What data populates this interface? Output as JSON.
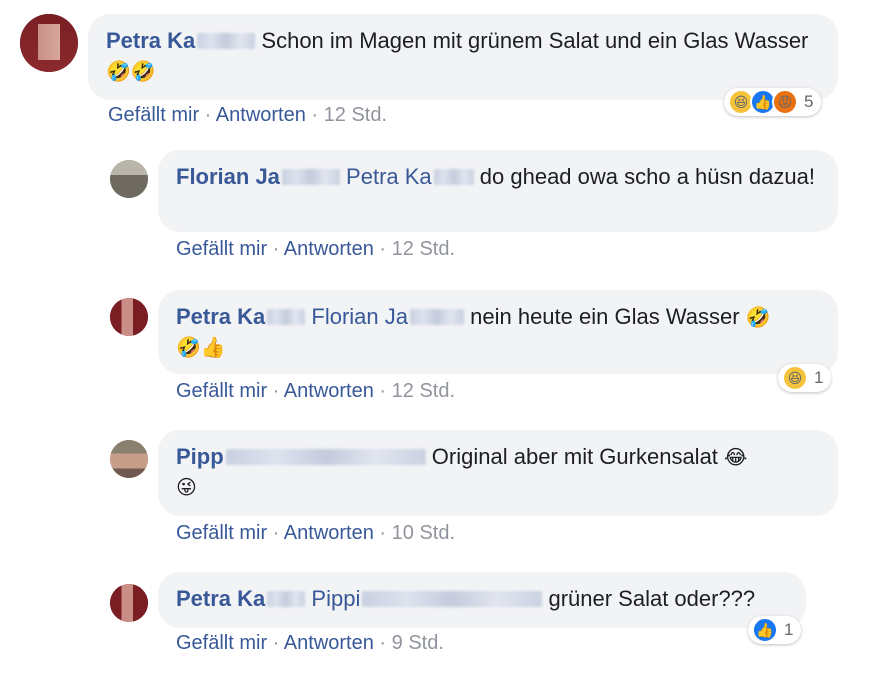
{
  "comments": [
    {
      "author": "Petra Ka",
      "mention": "",
      "text": "Schon im Magen mit grünem Salat und ein Glas Wasser",
      "emojis": "🤣🤣",
      "actions": {
        "like": "Gefällt mir",
        "reply": "Antworten",
        "time": "12 Std."
      },
      "reaction_count": "5"
    },
    {
      "author": "Florian Ja",
      "mention": "Petra Ka",
      "text": "do ghead owa scho a hüsn dazua!",
      "actions": {
        "like": "Gefällt mir",
        "reply": "Antworten",
        "time": "12 Std."
      }
    },
    {
      "author": "Petra Ka",
      "mention": "Florian Ja",
      "text": "nein heute ein Glas Wasser",
      "emojis": "🤣",
      "emojis2": "🤣👍",
      "actions": {
        "like": "Gefällt mir",
        "reply": "Antworten",
        "time": "12 Std."
      },
      "reaction_count": "1"
    },
    {
      "author": "Pipp",
      "mention": "",
      "text": "Original aber mit Gurkensalat",
      "emojis": "😂",
      "emojis2": "😜",
      "actions": {
        "like": "Gefällt mir",
        "reply": "Antworten",
        "time": "10 Std."
      }
    },
    {
      "author": "Petra Ka",
      "mention": "Pippi",
      "text": "grüner Salat oder???",
      "actions": {
        "like": "Gefällt mir",
        "reply": "Antworten",
        "time": "9 Std."
      },
      "reaction_count": "1"
    }
  ],
  "reaction_icons": {
    "haha": "haha-icon",
    "like": "like-icon",
    "angry": "angry-icon"
  },
  "colors": {
    "name": "#385898",
    "bubble": "#f2f3f5",
    "meta": "#90949c",
    "like": "#1877f2"
  }
}
